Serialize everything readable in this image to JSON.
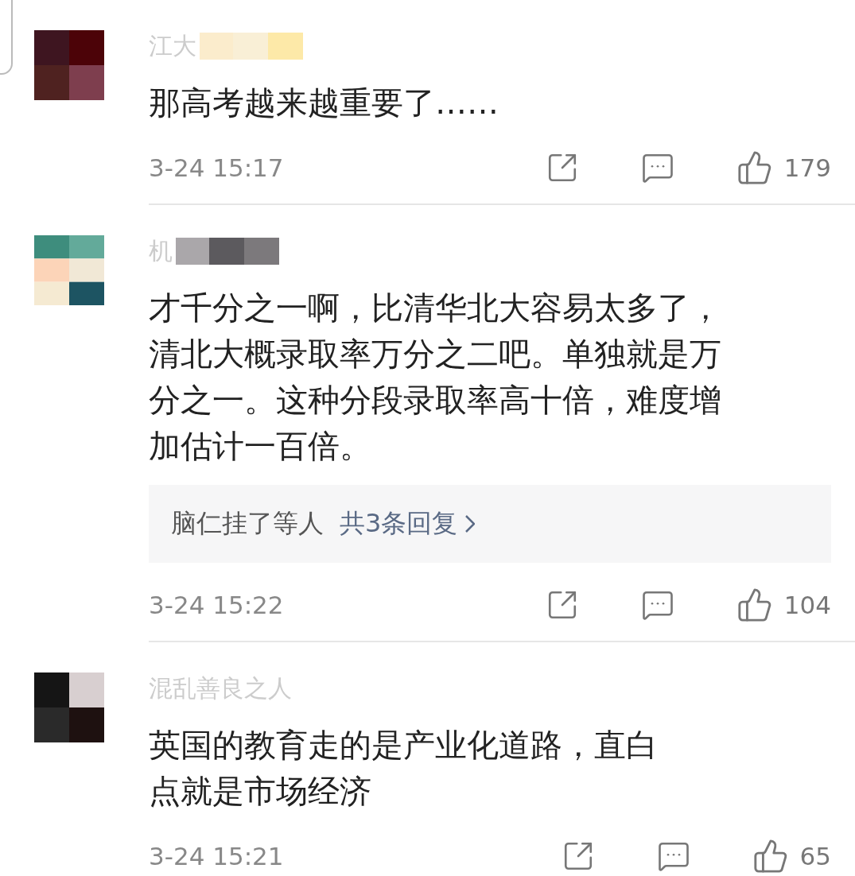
{
  "comments": [
    {
      "username": "江大",
      "username_masked": true,
      "text": "那高考越来越重要了……",
      "time": "3-24 15:17",
      "likes": "179"
    },
    {
      "username": "机",
      "username_masked": true,
      "text": "才千分之一啊，比清华北大容易太多了，清北大概录取率万分之二吧。单独就是万分之一。这种分段录取率高十倍，难度增加估计一百倍。",
      "replies": {
        "names": "脑仁挂了等人",
        "link": "共3条回复"
      },
      "time": "3-24 15:22",
      "likes": "104"
    },
    {
      "username": "混乱善良之人",
      "text": "英国的教育走的是产业化道路，直白点就是市场经济",
      "time": "3-24 15:21",
      "likes": "65"
    }
  ]
}
